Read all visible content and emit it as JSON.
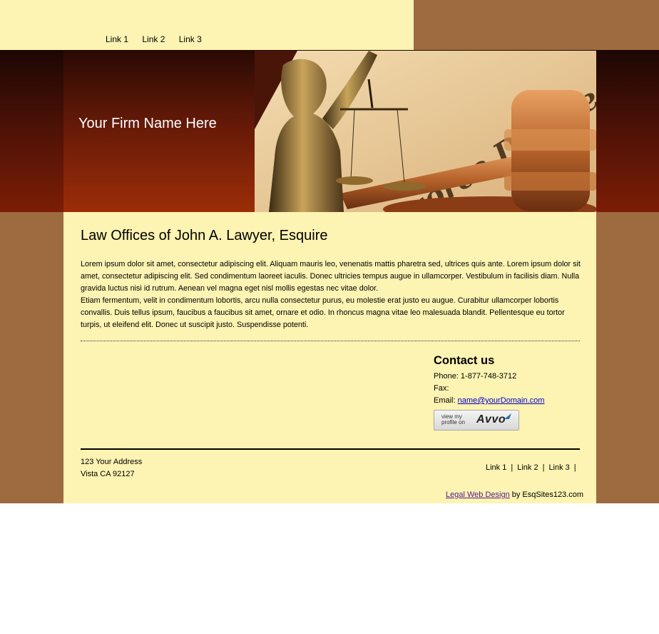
{
  "topnav": {
    "links": [
      "Link 1",
      "Link 2",
      "Link 3"
    ]
  },
  "banner": {
    "firm_name": "Your Firm Name Here",
    "image_text": "Divorce Decree"
  },
  "main": {
    "heading": "Law Offices of John A. Lawyer, Esquire",
    "paragraph_1": "Lorem ipsum dolor sit amet, consectetur adipiscing elit. Aliquam mauris leo, venenatis mattis pharetra sed, ultrices quis ante. Lorem ipsum dolor sit amet, consectetur adipiscing elit. Sed condimentum laoreet iaculis. Donec ultricies tempus augue in ullamcorper. Vestibulum in facilisis diam. Nulla gravida luctus nisi id rutrum. Aenean vel magna eget nisl mollis egestas nec vitae dolor.",
    "paragraph_2": "Etiam fermentum, velit in condimentum lobortis, arcu nulla consectetur purus, eu molestie erat justo eu augue. Curabitur ullamcorper lobortis convallis. Duis tellus ipsum, faucibus a faucibus sit amet, ornare et odio. In rhoncus magna vitae leo malesuada blandit. Pellentesque eu tortor turpis, ut eleifend elit. Donec ut suscipit justo. Suspendisse potenti."
  },
  "contact": {
    "title": "Contact us",
    "phone": "Phone: 1-877-748-3712",
    "fax": "Fax:",
    "email_label": "Email:",
    "email": "name@yourDomain.com",
    "avvo_small_line1": "view my",
    "avvo_small_line2": "profile on",
    "avvo_logo": "Avvo"
  },
  "footer": {
    "address_line1": "123 Your Address",
    "address_line2": "Vista CA 92127",
    "links": [
      "Link 1",
      "Link 2",
      "Link 3"
    ],
    "separator": "|",
    "credit_link": "Legal Web Design",
    "credit_text": " by EsqSites123.com"
  },
  "colors": {
    "cream": "#fdf3b2",
    "brown_band": "#9e6b40",
    "banner_dark": "#1c0703",
    "banner_red": "#9c2d08"
  }
}
